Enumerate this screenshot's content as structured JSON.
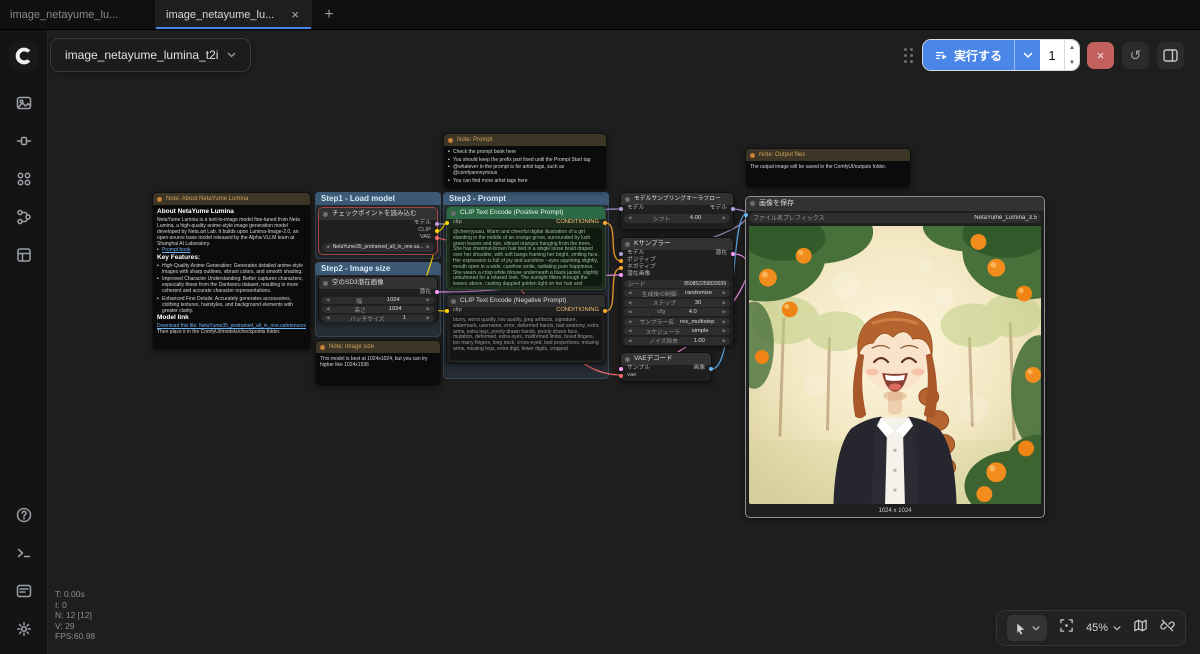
{
  "tabs": {
    "tab1": {
      "label": "image_netayume_lu..."
    },
    "tab2": {
      "label": "image_netayume_lu...",
      "close": "×"
    },
    "new_tab": "+"
  },
  "topbar": {
    "workflow_name": "image_netayume_lumina_t2i",
    "run_label": "実行する",
    "batch_count": "1",
    "cancel": "×",
    "history_icon": "↺"
  },
  "groups": {
    "step1": "Step1 - Load model",
    "step2": "Step2 - Image size",
    "step3": "Step3 - Prompt"
  },
  "notes": {
    "about": {
      "title": "Note: About NetaYume Lumina",
      "heading": "About NetaYume Lumina",
      "p1": "NetaYume Lumina is a text-to-image model fine-tuned from Neta Lumina, a high-quality anime-style image generation model developed by Neta.art Lab. It builds upon Lumina-Image-2.0, an open-source base model released by the Alpha-VLLM team at Shanghai AI Laboratory.",
      "link1": "Prompt book",
      "features_heading": "Key Features:",
      "f1": "High-Quality Anime Generation: Generates detailed anime-style images with sharp outlines, vibrant colors, and smooth shading.",
      "f2": "Improved Character Understanding: Better captures characters, especially those from the Danbooru dataset, resulting in more coherent and accurate character representations.",
      "f3": "Enhanced Fine Details: Accurately generates accessories, clothing textures, hairstyles, and background elements with greater clarity.",
      "model_link_heading": "Model link",
      "download_text": "Download this file: NetaYume35_pretrained_all_in_one.safetensors",
      "place_text": "Then place it in the ComfyUI/models/checkpoints folder."
    },
    "prompt": {
      "title": "Note: Prompt",
      "l1": "Check the prompt book here",
      "l2": "You should keep the prefix part fixed until the Prompt Start tag",
      "l3": "@whatever in the prompt is for artist tags, such as @comfyanonymous",
      "l4": "You can find more artist tags here"
    },
    "size": {
      "title": "Note: Image size",
      "body": "This model is best at 1024x1024, but you can try higher like 1024x1536"
    },
    "output": {
      "title": "Note: Output files",
      "body": "The output image will be saved in the ComfyUI/outputs folder."
    }
  },
  "nodes": {
    "load_checkpoint": {
      "title": "チェックポイントを読み込む",
      "outputs": [
        "モデル",
        "CLIP",
        "VAE"
      ],
      "widget_value": "NetaYume35_pretrained_all_in_one.sa..."
    },
    "empty_latent": {
      "title": "空のSD3潜在画像",
      "output": "潜在",
      "widgets": [
        {
          "label": "幅",
          "value": "1024"
        },
        {
          "label": "高さ",
          "value": "1024"
        },
        {
          "label": "バッチサイズ",
          "value": "1"
        }
      ]
    },
    "clip_positive": {
      "title": "CLIP Text Encode (Positive Prompt)",
      "input": "clip",
      "output": "CONDITIONING",
      "text": "@cheerypusu, Warm and cheerful digital illustration of a girl standing in the middle of an orange grove, surrounded by lush green leaves and ripe, vibrant oranges hanging from the trees. She has chestnut-brown hair tied in a single loose braid draped over her shoulder, with soft bangs framing her bright, smiling face. Her expression is full of joy and sunshine - eyes squinting slightly, mouth open in a wide, carefree smile, radiating pure happiness. She wears a crisp white blouse underneath a black jacket, slightly unbuttoned for a relaxed look. The sunlight filters through the leaves above, casting dappled golden light on her hair and shoulders, creating a warm, inviting atmosphere."
    },
    "clip_negative": {
      "title": "CLIP Text Encode (Negative Prompt)",
      "input": "clip",
      "output": "CONDITIONING",
      "text": "blurry, worst quality, low quality, jpeg artifacts, signature, watermark, username, error, deformed hands, bad anatomy, extra arms, extra legs, poorly drawn hands, poorly drawn face, mutation, deformed, extra eyes, malformed limbs, fused fingers, too many fingers, long neck, cross-eyed, bad proportions, missing arms, missing legs, extra digit, fewer digits, cropped"
    },
    "model_sampling": {
      "title": "モデルサンプリングオーラフロー",
      "input": "モデル",
      "output": "モデル",
      "widgets": [
        {
          "label": "シフト",
          "value": "4.00"
        }
      ]
    },
    "ksampler": {
      "title": "Kサンプラー",
      "inputs": [
        "モデル",
        "ポジティブ",
        "ネガティブ",
        "潜在画像"
      ],
      "output": "潜在",
      "widgets": [
        {
          "label": "シード",
          "value": "850852259833039"
        },
        {
          "label": "生成後の制御",
          "value": "randomize"
        },
        {
          "label": "ステップ",
          "value": "30"
        },
        {
          "label": "cfg",
          "value": "4.0"
        },
        {
          "label": "サンプラー名",
          "value": "res_multistep"
        },
        {
          "label": "スケジューラ",
          "value": "simple"
        },
        {
          "label": "ノイズ除去",
          "value": "1.00"
        }
      ]
    },
    "vae_decode": {
      "title": "VAEデコード",
      "inputs": [
        "サンプル",
        "vae"
      ],
      "output": "画像"
    },
    "save_image": {
      "title": "画像を保存",
      "widget_label": "ファイル名プレフィックス",
      "widget_value": "NetaYume_Lumina_3.5",
      "caption": "1024 x 1024"
    }
  },
  "stats": {
    "t": "T: 0.00s",
    "i": "I: 0",
    "n": "N: 12 [12]",
    "v": "V: 29",
    "fps": "FPS:60.98"
  },
  "zoom_toolbar": {
    "zoom": "45%"
  }
}
